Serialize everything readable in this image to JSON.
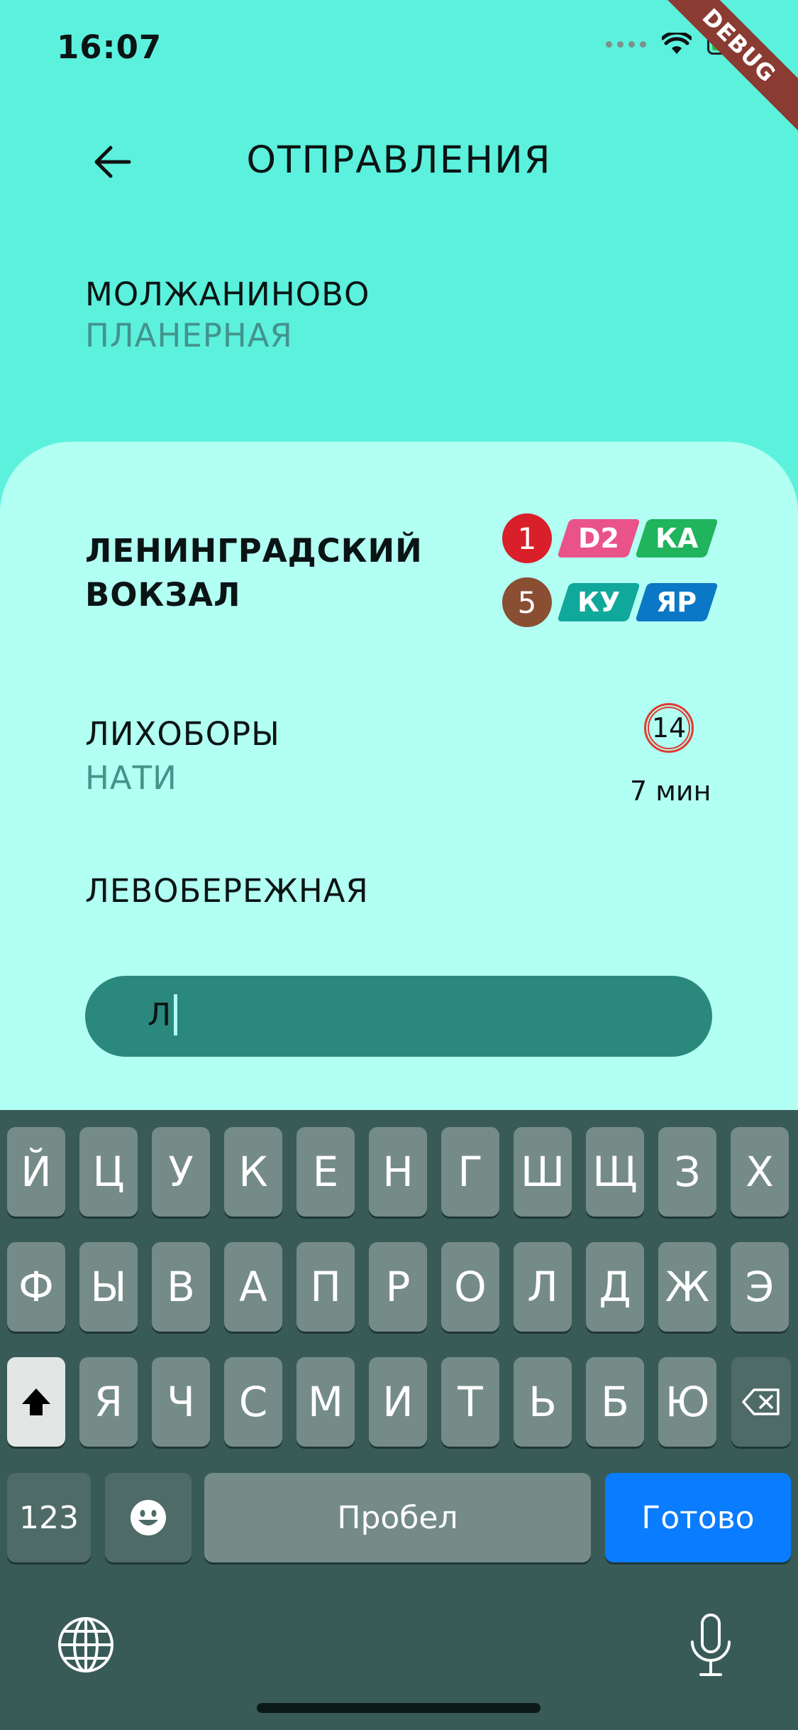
{
  "status_bar": {
    "time": "16:07",
    "debug_label": "DEBUG"
  },
  "header": {
    "title": "ОТПРАВЛЕНИЯ"
  },
  "route": {
    "from": "МОЛЖАНИНОВО",
    "to": "ПЛАНЕРНАЯ"
  },
  "stations": [
    {
      "name_line1": "ЛЕНИНГРАДСКИЙ",
      "name_line2": "ВОКЗАЛ",
      "lines_row1": [
        "1",
        "D2",
        "КА"
      ],
      "lines_row2": [
        "5",
        "КУ",
        "ЯР"
      ]
    },
    {
      "name": "ЛИХОБОРЫ",
      "sub": "НАТИ",
      "line": "14",
      "eta": "7 мин"
    },
    {
      "name": "ЛЕВОБЕРЕЖНАЯ"
    }
  ],
  "search": {
    "value": "Л"
  },
  "keyboard": {
    "row1": [
      "Й",
      "Ц",
      "У",
      "К",
      "Е",
      "Н",
      "Г",
      "Ш",
      "Щ",
      "З",
      "Х"
    ],
    "row2": [
      "Ф",
      "Ы",
      "В",
      "А",
      "П",
      "Р",
      "О",
      "Л",
      "Д",
      "Ж",
      "Э"
    ],
    "row3": [
      "Я",
      "Ч",
      "С",
      "М",
      "И",
      "Т",
      "Ь",
      "Б",
      "Ю"
    ],
    "numbers_label": "123",
    "space_label": "Пробел",
    "done_label": "Готово"
  },
  "colors": {
    "background": "#5bf1dd",
    "panel": "#b2fff3",
    "search_field": "#2b887d",
    "line_1": "#d91f2a",
    "line_5": "#8a4e33",
    "line_D2": "#e9538a",
    "line_KA": "#20b45d",
    "line_KU": "#11a89c",
    "line_YAR": "#0b78c6",
    "keyboard_bg": "#385b57",
    "done_key": "#0a7cff"
  }
}
